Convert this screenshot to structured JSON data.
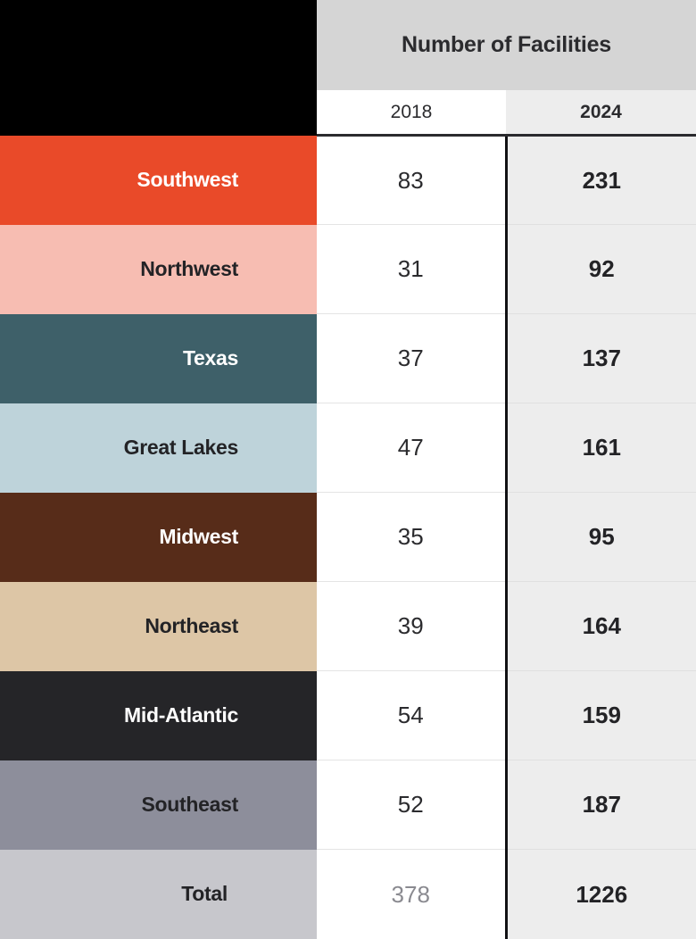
{
  "table": {
    "corner_label": "",
    "group_header": "Number of Facilities",
    "columns": [
      {
        "key": "y2018",
        "label": "2018"
      },
      {
        "key": "y2024",
        "label": "2024"
      }
    ],
    "rows": [
      {
        "region": "Southwest",
        "y2018": "83",
        "y2024": "231",
        "swatch": "#e94a29",
        "text_color": "#ffffff"
      },
      {
        "region": "Northwest",
        "y2018": "31",
        "y2024": "92",
        "swatch": "#f7bdb2",
        "text_color": "#232326"
      },
      {
        "region": "Texas",
        "y2018": "37",
        "y2024": "137",
        "swatch": "#3e6069",
        "text_color": "#ffffff"
      },
      {
        "region": "Great Lakes",
        "y2018": "47",
        "y2024": "161",
        "swatch": "#bed3da",
        "text_color": "#232326"
      },
      {
        "region": "Midwest",
        "y2018": "35",
        "y2024": "95",
        "swatch": "#572c19",
        "text_color": "#ffffff"
      },
      {
        "region": "Northeast",
        "y2018": "39",
        "y2024": "164",
        "swatch": "#ddc6a6",
        "text_color": "#232326"
      },
      {
        "region": "Mid-Atlantic",
        "y2018": "54",
        "y2024": "159",
        "swatch": "#252528",
        "text_color": "#ffffff"
      },
      {
        "region": "Southeast",
        "y2018": "52",
        "y2024": "187",
        "swatch": "#8d8e9b",
        "text_color": "#232326"
      },
      {
        "region": "Total",
        "y2018": "378",
        "y2024": "1226",
        "swatch": "#c7c7cc",
        "text_color": "#232326"
      }
    ]
  },
  "chart_data": {
    "type": "table",
    "title": "Number of Facilities",
    "categories": [
      "Southwest",
      "Northwest",
      "Texas",
      "Great Lakes",
      "Midwest",
      "Northeast",
      "Mid-Atlantic",
      "Southeast",
      "Total"
    ],
    "series": [
      {
        "name": "2018",
        "values": [
          83,
          31,
          37,
          47,
          35,
          39,
          54,
          52,
          378
        ]
      },
      {
        "name": "2024",
        "values": [
          231,
          92,
          137,
          161,
          95,
          164,
          159,
          187,
          1226
        ]
      }
    ],
    "xlabel": "",
    "ylabel": "",
    "legend_position": "top",
    "grid": false,
    "row_colors": [
      "#e94a29",
      "#f7bdb2",
      "#3e6069",
      "#bed3da",
      "#572c19",
      "#ddc6a6",
      "#252528",
      "#8d8e9b",
      "#c7c7cc"
    ]
  }
}
